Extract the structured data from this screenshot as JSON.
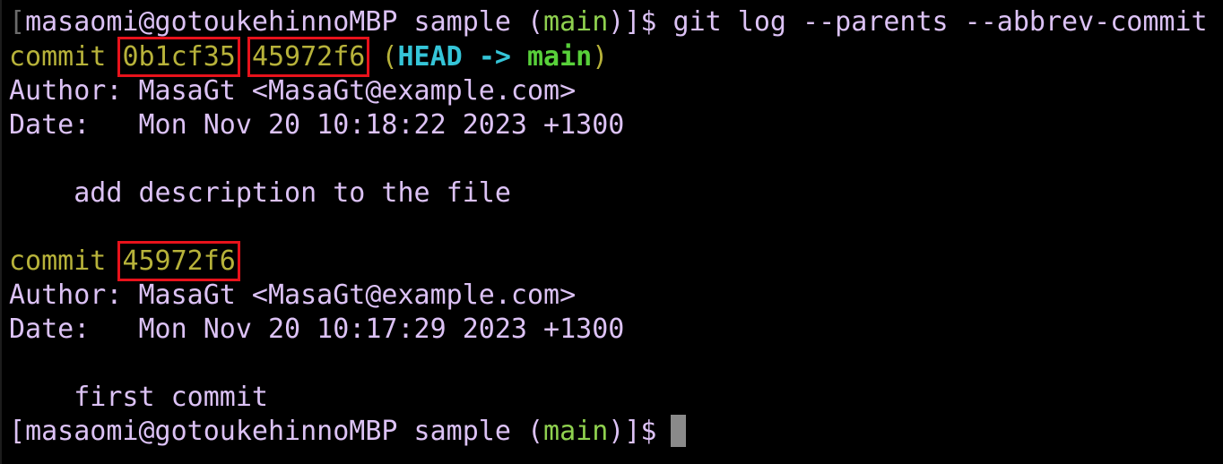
{
  "prompt": {
    "open_bracket": "[",
    "user_host": "masaomi@gotoukehinnoMBP",
    "directory": "sample",
    "branch_open": "(",
    "branch": "main",
    "branch_close": ")",
    "close_bracket": "]",
    "dollar": "$"
  },
  "command": "git log --parents --abbrev-commit",
  "commits": [
    {
      "keyword": "commit",
      "hash": "0b1cf35",
      "parent": "45972f6",
      "refs_open": "(",
      "head": "HEAD",
      "arrow": "->",
      "ref_branch": "main",
      "refs_close": ")",
      "author_label": "Author:",
      "author": "MasaGt <MasaGt@example.com>",
      "date_label": "Date:",
      "date": "Mon Nov 20 10:18:22 2023 +1300",
      "message": "add description to the file"
    },
    {
      "keyword": "commit",
      "hash": "45972f6",
      "author_label": "Author:",
      "author": "MasaGt <MasaGt@example.com>",
      "date_label": "Date:",
      "date": "Mon Nov 20 10:17:29 2023 +1300",
      "message": "first commit"
    }
  ],
  "colors": {
    "background": "#000000",
    "text": "#dcc2f5",
    "branch": "#8fd14f",
    "hash": "#b7b23a",
    "head": "#35c5d8",
    "highlight_box": "#e8121b"
  }
}
